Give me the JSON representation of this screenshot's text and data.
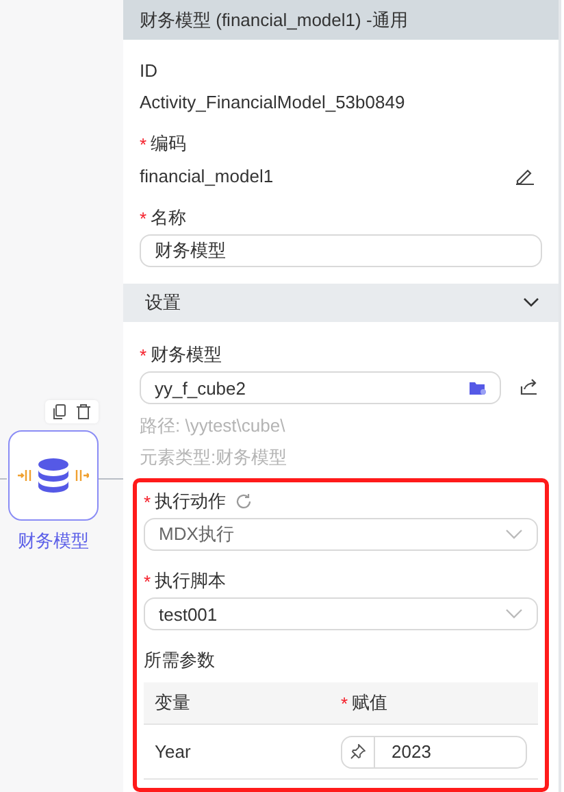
{
  "node": {
    "label": "财务模型"
  },
  "panel": {
    "title": "财务模型 (financial_model1) -通用",
    "id": {
      "label": "ID",
      "value": "Activity_FinancialModel_53b0849"
    },
    "code": {
      "label": "编码",
      "required_mark": "*",
      "value": "financial_model1"
    },
    "name": {
      "label": "名称",
      "required_mark": "*",
      "value": "财务模型"
    },
    "settings": {
      "title": "设置",
      "expanded": true,
      "model": {
        "label": "财务模型",
        "required_mark": "*",
        "value": "yy_f_cube2"
      },
      "path": "路径: \\yytest\\cube\\",
      "element_type": "元素类型:财务模型",
      "action": {
        "label": "执行动作",
        "required_mark": "*",
        "value": "MDX执行"
      },
      "script": {
        "label": "执行脚本",
        "required_mark": "*",
        "value": "test001"
      },
      "params_title": "所需参数",
      "params_columns": [
        {
          "label": "变量"
        },
        {
          "label": "赋值",
          "required_mark": "*"
        }
      ],
      "params_rows": [
        {
          "variable": "Year",
          "value": "2023"
        }
      ]
    }
  }
}
